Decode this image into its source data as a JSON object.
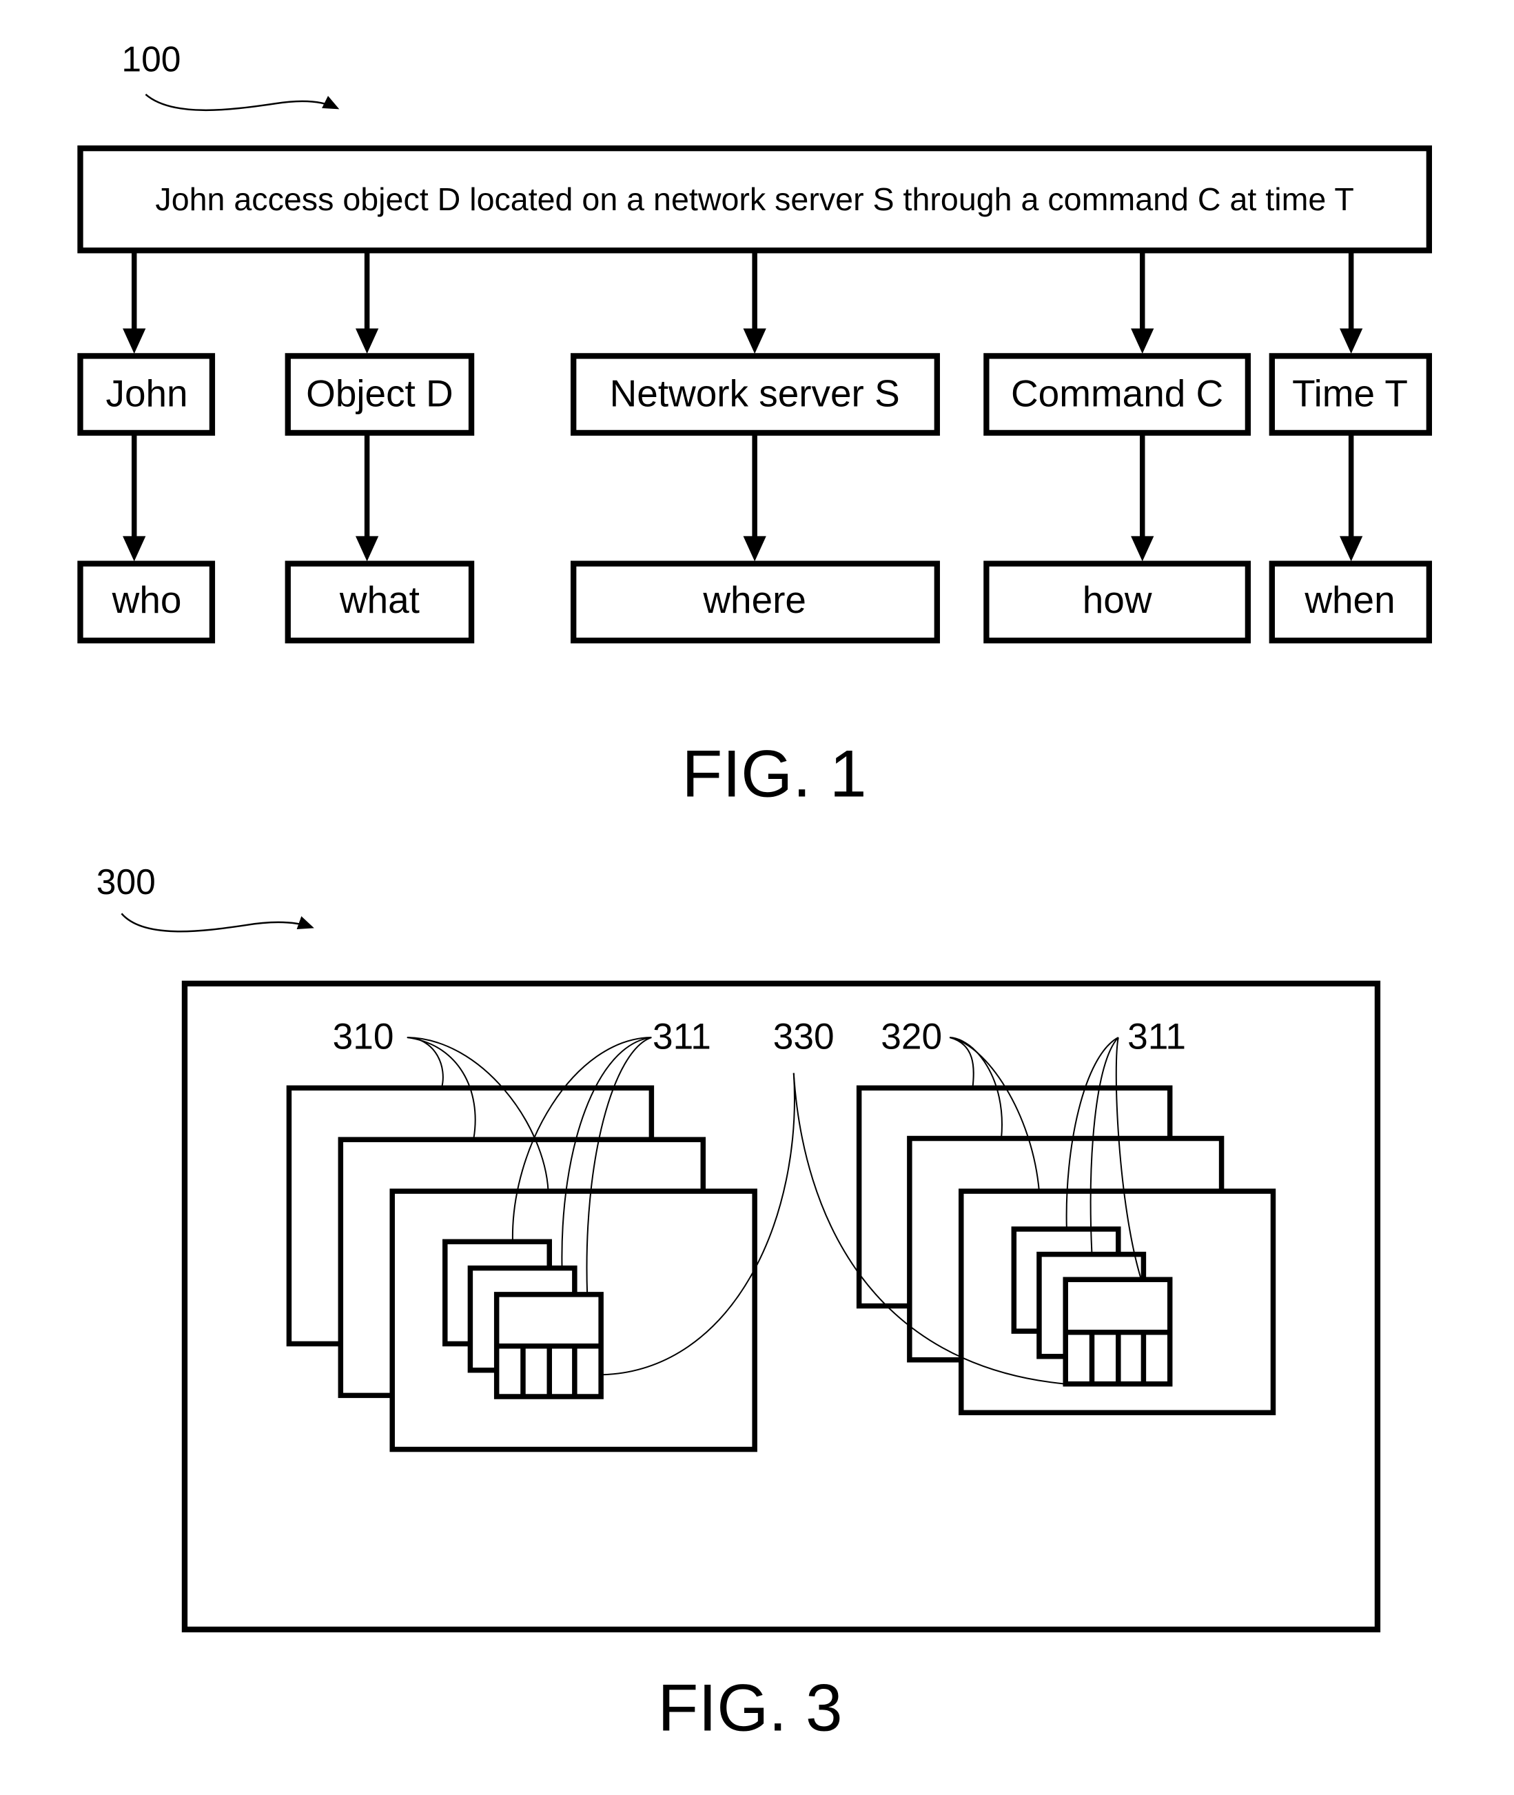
{
  "fig1": {
    "ref_label": "100",
    "sentence": "John access object D located on a network server S through a command C at time T",
    "entities": [
      {
        "label": "John",
        "role": "who"
      },
      {
        "label": "Object D",
        "role": "what"
      },
      {
        "label": "Network server S",
        "role": "where"
      },
      {
        "label": "Command C",
        "role": "how"
      },
      {
        "label": "Time T",
        "role": "when"
      }
    ],
    "caption": "FIG. 1"
  },
  "fig3": {
    "ref_label": "300",
    "labels": {
      "group_left": "310",
      "items_left": "311",
      "connector": "330",
      "group_right": "320",
      "items_right": "311"
    },
    "caption": "FIG. 3"
  }
}
